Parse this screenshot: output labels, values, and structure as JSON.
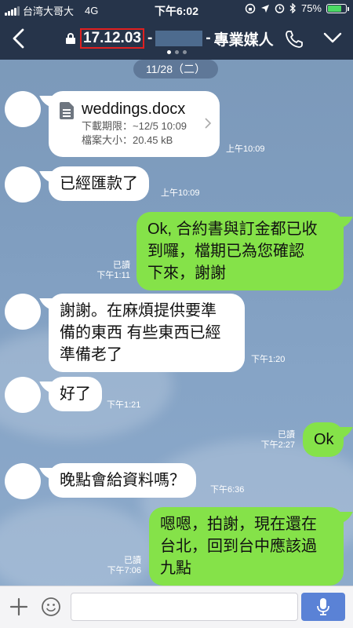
{
  "status_bar": {
    "carrier": "台湾大哥大",
    "network": "4G",
    "time": "下午6:02",
    "battery_text": "75%",
    "battery_level": 0.75
  },
  "header": {
    "title_prefix": "17.12.03",
    "title_separator_left": "-",
    "title_separator_right": "-",
    "title_suffix": "專業媒人"
  },
  "chat": {
    "date_label": "11/28（二）",
    "file": {
      "name": "weddings.docx",
      "deadline": "下載期限：~12/5 10:09",
      "size": "檔案大小：20.45 kB",
      "time": "上午10:09"
    },
    "messages": [
      {
        "id": "m1",
        "text": "已經匯款了",
        "time": "上午10:09"
      },
      {
        "id": "m2",
        "text": "Ok, 合約書與訂金都已收\n到囉，檔期已為您確認\n下來，謝謝",
        "read": "已讀",
        "time": "下午1:11"
      },
      {
        "id": "m3",
        "text": "謝謝。在麻煩提供要準\n備的東西 有些東西已經\n準備老了",
        "time": "下午1:20"
      },
      {
        "id": "m4",
        "text": "好了",
        "time": "下午1:21"
      },
      {
        "id": "m5",
        "text": "Ok",
        "read": "已讀",
        "time": "下午2:27"
      },
      {
        "id": "m6",
        "text": "晚點會給資料嗎？",
        "time": "下午6:36"
      },
      {
        "id": "m7",
        "text": "嗯嗯，拍謝，現在還在\n台北，回到台中應該過\n九點",
        "read": "已讀",
        "time": "下午7:06"
      }
    ]
  },
  "input_bar": {
    "placeholder": ""
  },
  "colors": {
    "header_bg": "#26344a",
    "outgoing_bubble": "#85e249",
    "incoming_bubble": "#ffffff",
    "mic_button": "#5a82d6"
  },
  "icons": [
    "back-chevron-icon",
    "lock-icon",
    "phone-icon",
    "chevron-down-icon",
    "plus-icon",
    "smiley-icon",
    "microphone-icon",
    "document-icon",
    "chevron-right-icon"
  ]
}
